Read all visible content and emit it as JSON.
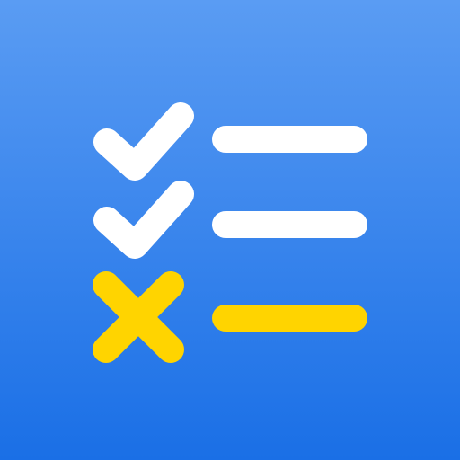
{
  "icon": {
    "name": "checklist-app-icon",
    "colors": {
      "background_top": "#5A9CF3",
      "background_bottom": "#1A6FE6",
      "check": "#FFFFFF",
      "line_done": "#FFFFFF",
      "cross": "#FFD400",
      "line_failed": "#FFD400"
    },
    "items": [
      {
        "status": "done",
        "icon": "checkmark-icon"
      },
      {
        "status": "done",
        "icon": "checkmark-icon"
      },
      {
        "status": "failed",
        "icon": "cross-icon"
      }
    ]
  }
}
